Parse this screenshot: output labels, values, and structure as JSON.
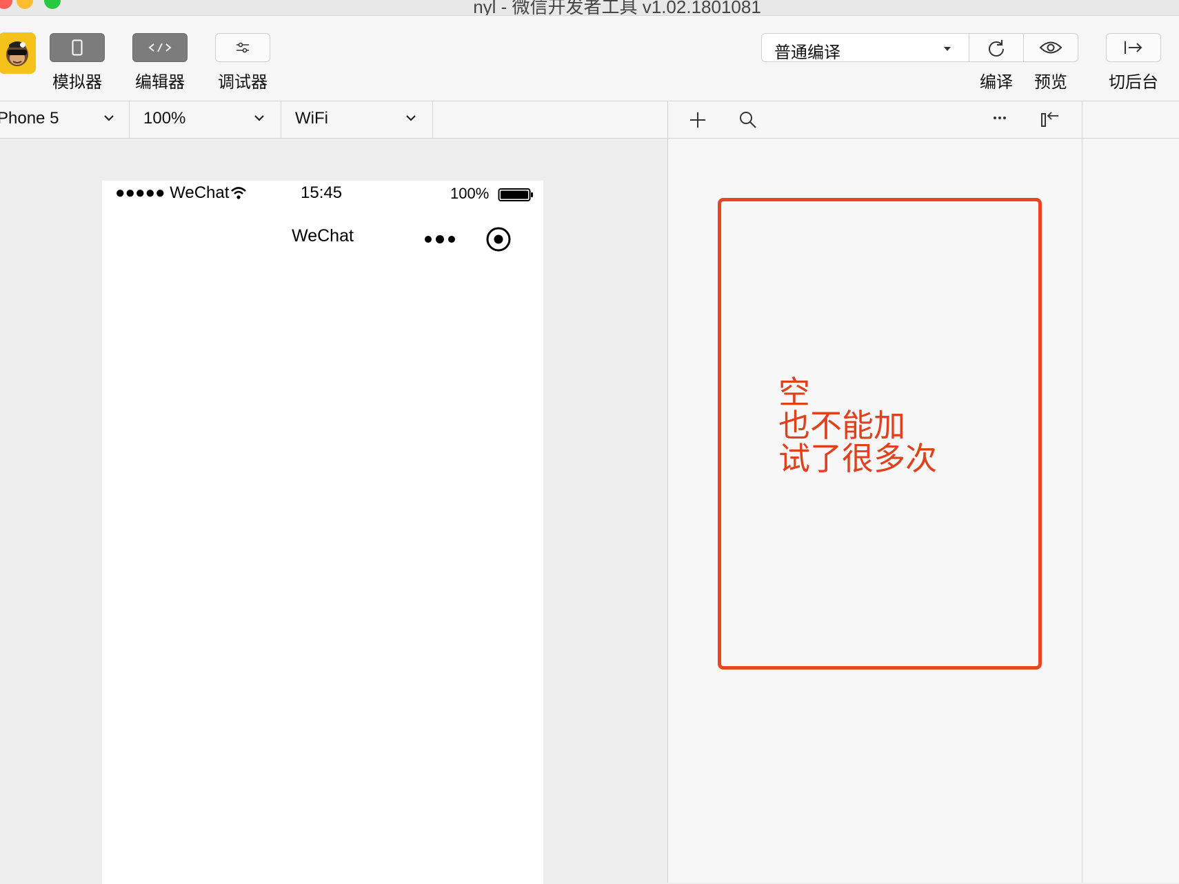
{
  "window": {
    "title": "nyl - 微信开发者工具 v1.02.1801081"
  },
  "toolbar": {
    "simulator_label": "模拟器",
    "editor_label": "编辑器",
    "debugger_label": "调试器",
    "compile_mode": "普通编译",
    "compile_label": "编译",
    "preview_label": "预览",
    "background_label": "切后台",
    "avatar_icon": "monkey-avatar"
  },
  "subbar": {
    "device": "Phone 5",
    "zoom": "100%",
    "network": "WiFi"
  },
  "phone": {
    "carrier": "●●●●● WeChat",
    "time": "15:45",
    "battery": "100%",
    "nav_title": "WeChat"
  },
  "annotation": {
    "text": "空\n也不能加\n试了很多次",
    "color": "#e8461e"
  }
}
